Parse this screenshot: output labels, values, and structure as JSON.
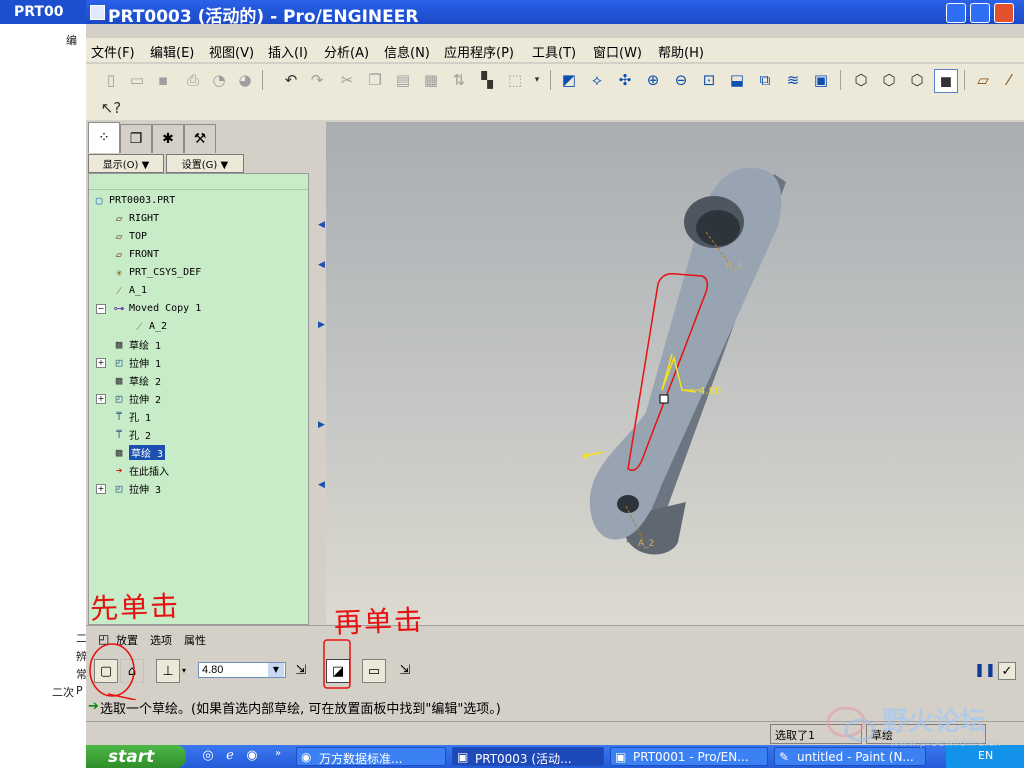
{
  "window": {
    "title": "PRT0003 (活动的) - Pro/ENGINEER",
    "colors": {
      "titlebar": "#1a49c7",
      "tree_bg": "#c8ecc8",
      "accent_red": "#e81010",
      "selection": "#1b4fb0"
    }
  },
  "background": {
    "ghost_title": "PRT00",
    "fragments": [
      "编",
      "二",
      "辨",
      "常",
      "二次",
      "P"
    ]
  },
  "menu": {
    "items": [
      "文件(F)",
      "编辑(E)",
      "视图(V)",
      "插入(I)",
      "分析(A)",
      "信息(N)",
      "应用程序(P)",
      "工具(T)",
      "窗口(W)",
      "帮助(H)"
    ]
  },
  "toolbar": {
    "icons": [
      "new-icon",
      "open-icon",
      "save-icon",
      "print-icon",
      "send-icon",
      "send2-icon",
      "undo-icon",
      "redo-icon",
      "cut-icon",
      "copy-icon",
      "paste-icon",
      "paste-special-icon",
      "regenerate-icon",
      "find-icon",
      "select-box-icon",
      "sketch-view-icon",
      "datum-icon",
      "spin-center-icon",
      "zoom-in-icon",
      "zoom-out-icon",
      "refit-icon",
      "reorient-icon",
      "saved-views-icon",
      "layers-icon",
      "view-manager-icon",
      "shading-icon",
      "hidden-line-icon",
      "no-hidden-icon",
      "wireframe-icon",
      "datum-planes-icon",
      "datum-axes-icon"
    ],
    "help_icon": "context-help-icon"
  },
  "tree": {
    "dropdowns": {
      "show": "显示(O) ▼",
      "settings": "设置(G) ▼"
    },
    "nodes": [
      {
        "label": "PRT0003.PRT",
        "icon": "part-icon",
        "depth": 0
      },
      {
        "label": "RIGHT",
        "icon": "datum-plane-icon",
        "depth": 1
      },
      {
        "label": "TOP",
        "icon": "datum-plane-icon",
        "depth": 1
      },
      {
        "label": "FRONT",
        "icon": "datum-plane-icon",
        "depth": 1
      },
      {
        "label": "PRT_CSYS_DEF",
        "icon": "csys-icon",
        "depth": 1
      },
      {
        "label": "A_1",
        "icon": "axis-icon",
        "depth": 1
      },
      {
        "label": "Moved Copy 1",
        "icon": "moved-copy-icon",
        "depth": 1,
        "expanded": true
      },
      {
        "label": "A_2",
        "icon": "axis-icon",
        "depth": 2
      },
      {
        "label": "草绘 1",
        "icon": "sketch-icon",
        "depth": 1
      },
      {
        "label": "拉伸 1",
        "icon": "extrude-icon",
        "depth": 1,
        "collapsed": true
      },
      {
        "label": "草绘 2",
        "icon": "sketch-icon",
        "depth": 1
      },
      {
        "label": "拉伸 2",
        "icon": "extrude-icon",
        "depth": 1,
        "collapsed": true
      },
      {
        "label": "孔 1",
        "icon": "hole-icon",
        "depth": 1
      },
      {
        "label": "孔 2",
        "icon": "hole-icon",
        "depth": 1
      },
      {
        "label": "草绘 3",
        "icon": "sketch-icon",
        "depth": 1,
        "selected": true
      },
      {
        "label": "在此插入",
        "icon": "insert-here-icon",
        "depth": 1
      },
      {
        "label": "拉伸 3",
        "icon": "extrude-icon",
        "depth": 1,
        "collapsed": true
      }
    ]
  },
  "graphics": {
    "dimension": "4.80",
    "axis_labels": [
      "A_1",
      "A_2"
    ]
  },
  "dashboard": {
    "tabs": [
      "放置",
      "选项",
      "属性"
    ],
    "depth_value": "4.80"
  },
  "message": "选取一个草绘。(如果首选内部草绘, 可在放置面板中找到\"编辑\"选项。)",
  "status": {
    "selected": "选取了1",
    "filter": "草绘"
  },
  "annotations": {
    "first_click": "先单击",
    "then_click": "再单击"
  },
  "taskbar": {
    "start": "start",
    "items": [
      {
        "label": "万方数据标准...",
        "icon": "firefox-icon"
      },
      {
        "label": "PRT0003 (活动...",
        "icon": "proe-icon",
        "active": true
      },
      {
        "label": "PRT0001 - Pro/EN...",
        "icon": "proe-icon"
      },
      {
        "label": "untitled - Paint (N...",
        "icon": "paint-icon"
      }
    ],
    "tray": {
      "lang": "EN"
    }
  },
  "watermark": {
    "text": "野火论坛",
    "url": "www.proewildfire.cn"
  }
}
